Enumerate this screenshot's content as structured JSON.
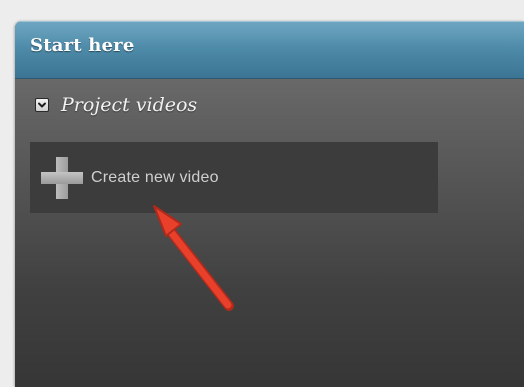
{
  "panel": {
    "title": "Start here"
  },
  "section": {
    "title": "Project videos",
    "expanded": true
  },
  "create_tile": {
    "label": "Create new video",
    "icon": "plus-icon"
  },
  "annotation": {
    "icon": "red-arrow-icon",
    "color": "#e8402a"
  },
  "colors": {
    "header": "#4d8aa8",
    "tile": "#3c3c3c"
  }
}
